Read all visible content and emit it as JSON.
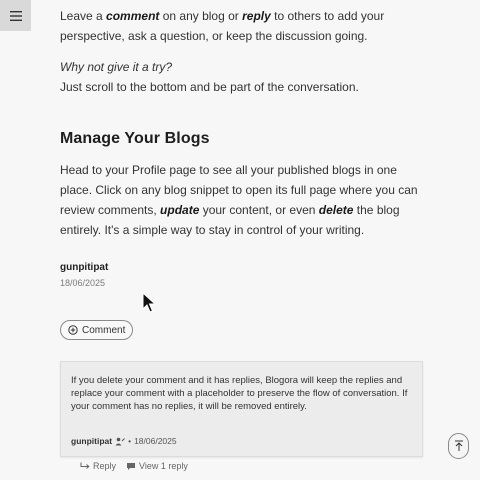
{
  "intro": {
    "line1_a": "Leave a ",
    "line1_b": "comment",
    "line1_c": " on any blog or ",
    "line1_d": "reply",
    "line1_e": " to others to add your perspective, ask a question, or keep the discussion going.",
    "italic_prompt": "Why not give it a try?",
    "line3": "Just scroll to the bottom and be part of the conversation."
  },
  "section": {
    "heading": "Manage Your Blogs",
    "p_a": "Head to your Profile page to see all your published blogs in one place. Click on any blog snippet to open its full page where you can review comments, ",
    "p_b": "update",
    "p_c": " your content, or even ",
    "p_d": "delete",
    "p_e": " the blog entirely. It's a simple way to stay in control of your writing."
  },
  "post_meta": {
    "author": "gunpitipat",
    "date": "18/06/2025"
  },
  "comment_button": {
    "label": "Comment"
  },
  "comment_card": {
    "text": "If you delete your comment and it has replies, Blogora will keep the replies and replace your comment with a placeholder to preserve the flow of conversation. If your comment has no replies, it will be removed entirely.",
    "author": "gunpitipat",
    "separator": "•",
    "date": "18/06/2025"
  },
  "comment_actions": {
    "reply": "Reply",
    "view_replies": "View 1 reply"
  },
  "icons": {
    "menu": "hamburger-icon",
    "comment_add": "plus-circle-icon",
    "author_badge": "user-edit-icon",
    "reply": "reply-arrow-icon",
    "view": "speech-bubble-icon",
    "scroll_top": "arrow-up-to-line-icon"
  }
}
